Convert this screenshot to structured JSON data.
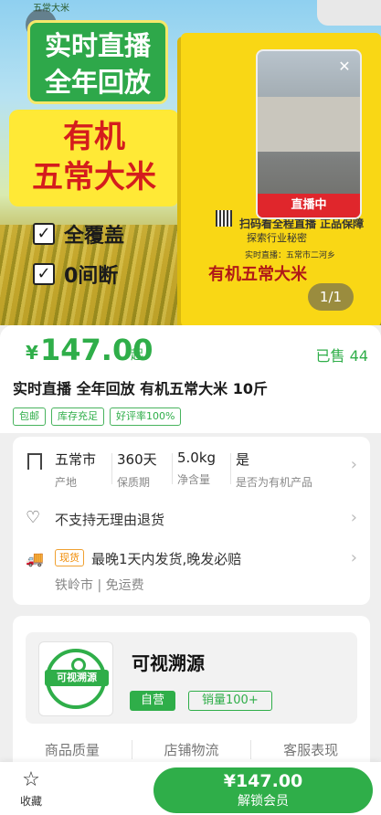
{
  "hero": {
    "top_brand": "五常大米",
    "live_badge_lines": [
      "实时直播",
      "全年回放"
    ],
    "product_name_lines": [
      "有机",
      "五常大米"
    ],
    "features": [
      "全覆盖",
      "0间断"
    ],
    "box_texts": {
      "scan_text": "扫码看全程直播 正品保障",
      "explore": "探索行业秘密",
      "live_location": "实时直播：五常市二河乡",
      "product": "有机五常大米"
    },
    "live_video_label": "直播中",
    "pager": "1/1"
  },
  "product": {
    "currency": "¥",
    "price": "147.00",
    "price_suffix": "起",
    "sold": "已售 44",
    "title": "实时直播 全年回放 有机五常大米 10斤",
    "tags": [
      "包邮",
      "库存充足",
      "好评率100%"
    ]
  },
  "specs": {
    "items": [
      {
        "value": "五常市",
        "key": "产地"
      },
      {
        "value": "360天",
        "key": "保质期"
      },
      {
        "value": "5.0kg",
        "key": "净含量"
      },
      {
        "value": "是",
        "key": "是否为有机产品"
      }
    ],
    "return_policy": "不支持无理由退货",
    "shipping_badge": "现货",
    "shipping_text": "最晚1天内发货,晚发必赔",
    "shipping_origin": "铁岭市 | 免运费"
  },
  "shop": {
    "logo_text": "可视溯源",
    "name": "可视溯源",
    "self_label": "自营",
    "sales_label": "销量100+",
    "metrics": [
      "商品质量",
      "店铺物流",
      "客服表现"
    ]
  },
  "bottom": {
    "favorite_label": "收藏",
    "buy_price": "¥147.00",
    "buy_sub": "解锁会员"
  }
}
